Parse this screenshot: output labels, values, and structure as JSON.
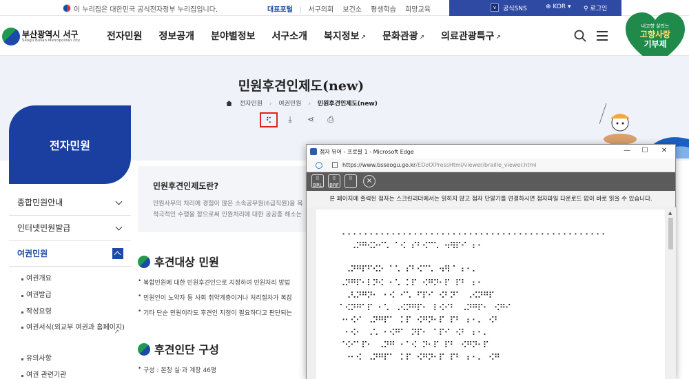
{
  "govbar": {
    "notice": "이 누리집은 대한민국 공식전자정부 누리집입니다.",
    "links": [
      "대표포털",
      "서구의회",
      "보건소",
      "평생학습",
      "희망교육"
    ],
    "sns": "공식SNS",
    "lang": "KOR",
    "login": "로그인"
  },
  "header": {
    "logo": "부산광역시 서구",
    "logo_sub": "Seogu Busan Metropolitan city",
    "nav": [
      "전자민원",
      "정보공개",
      "분야별정보",
      "서구소개",
      "복지정보",
      "문화관광",
      "의료관광특구"
    ],
    "badge": {
      "line1": "내고향 살리는",
      "line2": "고향사랑",
      "line3": "기부제"
    }
  },
  "page": {
    "title": "민원후견인제도(new)",
    "breadcrumb": [
      "전자민원",
      "여권민원",
      "민원후견인제도(new)"
    ]
  },
  "toolbar": {
    "braille": "⠫",
    "download": "⤓",
    "share": "⋖",
    "print": "⎙"
  },
  "sidebar": {
    "title": "전자민원",
    "items": [
      {
        "label": "종합민원안내"
      },
      {
        "label": "인터넷민원발급"
      },
      {
        "label": "여권민원"
      }
    ],
    "sub": [
      "여권개요",
      "여권발급",
      "작성요령",
      "여권서식(외교부 여권과 홈페이지)",
      "유의사항",
      "여권 관련기관"
    ]
  },
  "content": {
    "box_title": "민원후견인제도란?",
    "box_lines": [
      "민원사무의 처리에 경험이 많은 소속공무원(6급직원)을 복",
      "적극적인 수행을 함으로써 민원처리에 대한 공공종 해소는"
    ],
    "sec1": "후견대상 민원",
    "bullets": [
      "복합민원에 대한 민원후견인으로 지정하여 민원처리 방법",
      "민원인이 노약자 등 사회 취약계층이거나 처리절차가 복잡",
      "기타 단순 민원이라도 후견인 지정이 필요하다고 판단되는"
    ],
    "sec2": "후견인단 구성",
    "sec2_line": "구성 : 본청 실·과 계장 46명"
  },
  "popup": {
    "title": "점자 뷰어 - 프로필 1 - Microsoft Edge",
    "url_host": "https://www.bsseogu.go.kr",
    "url_path": "/EDotXPressHtml/viewer/braille_viewer.html",
    "btn1": "BRL",
    "btn2": "BRF",
    "close": "×",
    "notice": "본 페이지에 출력된 점자는 스크린리더에서는 읽히지 않고 점자 단말기를 연결하시면 점자파일 다운로드 없이 바로 읽을 수 있습니다.",
    "braille_lines": [
      "⠐⠐⠐⠐⠐⠐⠐⠐⠐⠐⠐⠐⠐⠐⠐⠐⠐⠐⠐⠐⠐⠐⠐⠐⠐⠐⠐⠐⠐⠐⠐⠐⠐⠐⠐⠐⠐⠐⠐⠐⠐⠐⠐⠐⠐⠐⠐⠐",
      "⠀⠀⠠⠝⠛⠪⠕⠊⠡⠀⠁⠪⠀⠎⠃⠪⠉⠡⠀⠲⠻⠏⠊⠀⠆⠂",
      "⠀⠠⠝⠛⠏⠋⠪⠕⠀⠁⠡⠀⠎⠃⠪⠉⠡⠀⠲⠻⠈⠀⠆⠂⠄",
      "⠠⠝⠛⠏⠂⠇⠝⠪⠀⠂⠡⠀⠅⠏⠀⠪⠛⠝⠂⠏⠀⠏⠃⠀⠆⠂",
      "⠀⠠⠣⠝⠛⠝⠂⠀⠂⠪⠀⠊⠡⠀⠋⠏⠊⠀⠪⠃⠝⠁⠀⠠⠪⠝⠛⠏",
      "⠁⠪⠝⠛⠁⠏⠀⠂⠡⠀⠠⠪⠝⠛⠏⠂⠀⠇⠪⠊⠃⠀⠠⠝⠛⠏⠂⠀⠪⠛⠊",
      "⠐⠂⠪⠊⠀⠠⠝⠛⠏⠁⠀⠅⠏⠀⠪⠛⠝⠂⠏⠀⠏⠃⠀⠆⠂⠄⠀⠪⠃",
      "⠀⠂⠪⠂⠀⠠⠡⠀⠂⠪⠛⠁⠀⠝⠏⠂⠀⠁⠏⠊⠀⠪⠃⠀⠆⠂⠄",
      "⠈⠪⠊⠁⠏⠂⠀⠠⠝⠛⠀⠂⠁⠪⠀⠝⠂⠏⠀⠏⠃⠀⠪⠛⠝⠂⠏",
      "⠀⠐⠂⠪⠀⠠⠝⠛⠏⠁⠀⠅⠏⠀⠪⠛⠝⠂⠏⠀⠏⠃⠀⠆⠂⠄⠀⠪⠛"
    ]
  }
}
